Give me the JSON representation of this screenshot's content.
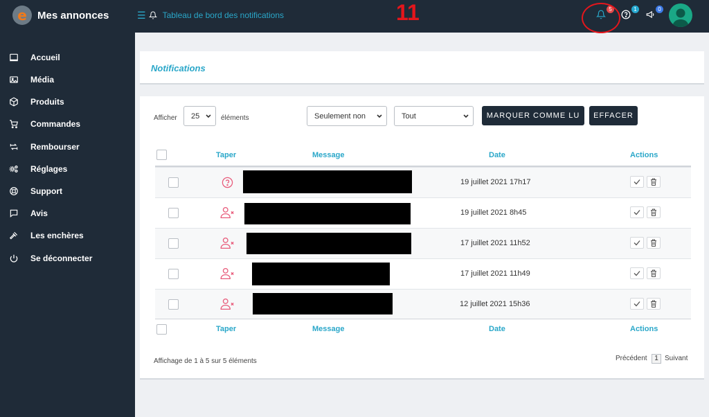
{
  "app": {
    "title": "Mes annonces",
    "logo_letter": "e"
  },
  "header": {
    "breadcrumb": "Tableau de bord des notifications",
    "annotation_number": "11",
    "badges": {
      "notifications": "5",
      "help": "1",
      "announcements": "0"
    }
  },
  "sidebar": {
    "items": [
      {
        "label": "Accueil",
        "icon": "dashboard-icon"
      },
      {
        "label": "Média",
        "icon": "image-icon"
      },
      {
        "label": "Produits",
        "icon": "cube-icon"
      },
      {
        "label": "Commandes",
        "icon": "cart-icon"
      },
      {
        "label": "Rembourser",
        "icon": "refund-icon"
      },
      {
        "label": "Réglages",
        "icon": "settings-icon"
      },
      {
        "label": "Support",
        "icon": "support-icon"
      },
      {
        "label": "Avis",
        "icon": "comment-icon"
      },
      {
        "label": "Les enchères",
        "icon": "gavel-icon"
      },
      {
        "label": "Se déconnecter",
        "icon": "power-icon"
      }
    ]
  },
  "page": {
    "title": "Notifications"
  },
  "controls": {
    "show_label": "Afficher",
    "page_size": "25",
    "elements_label": "éléments",
    "filter_read": "Seulement non",
    "filter_type": "Tout",
    "mark_read_button": "MARQUER COMME LU",
    "clear_button": "EFFACER"
  },
  "table": {
    "columns": [
      "Taper",
      "Message",
      "Date",
      "Actions"
    ],
    "rows": [
      {
        "type": "question-icon",
        "date": "19 juillet 2021 17h17"
      },
      {
        "type": "user-remove-icon",
        "date": "19 juillet 2021 8h45"
      },
      {
        "type": "user-remove-icon",
        "date": "17 juillet 2021 11h52"
      },
      {
        "type": "user-remove-icon",
        "date": "17 juillet 2021 11h49"
      },
      {
        "type": "user-remove-icon",
        "date": "12 juillet 2021 15h36"
      }
    ]
  },
  "footer": {
    "info": "Affichage de 1 à 5 sur 5 éléments",
    "prev": "Précédent",
    "current_page": "1",
    "next": "Suivant"
  },
  "colors": {
    "accent": "#2aa7c9",
    "sidebar": "#1f2b38",
    "alert": "#e4161c",
    "icon_pink": "#e85a7a"
  }
}
